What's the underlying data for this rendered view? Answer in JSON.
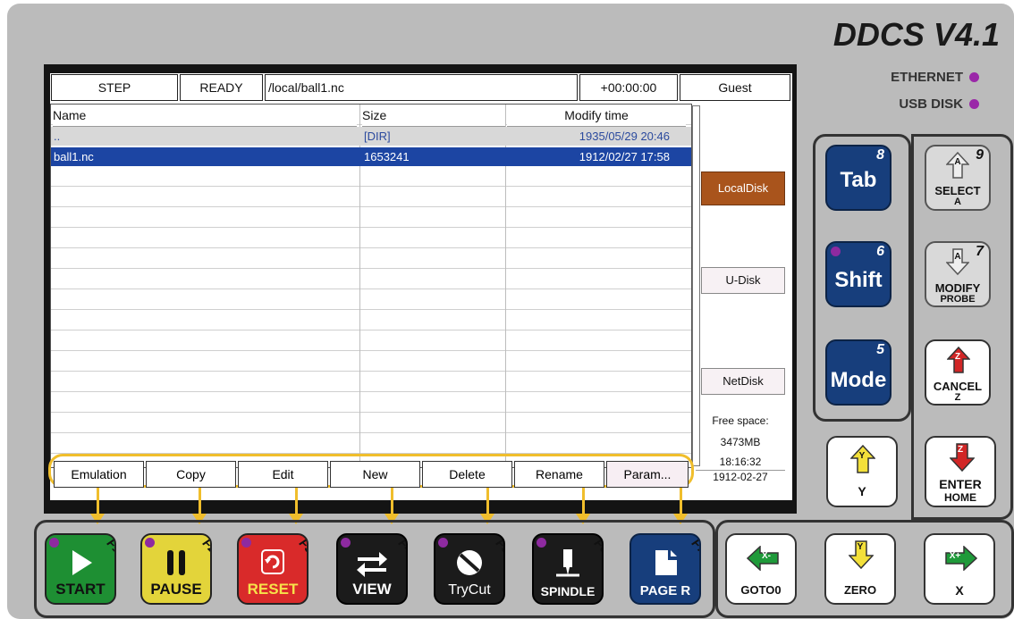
{
  "brand": "DDCS V4.1",
  "indicators": {
    "ethernet": "ETHERNET",
    "usb": "USB DISK"
  },
  "status_bar": {
    "mode": "STEP",
    "state": "READY",
    "path": "/local/ball1.nc",
    "timer": "+00:00:00",
    "user": "Guest"
  },
  "table": {
    "headers": {
      "name": "Name",
      "size": "Size",
      "modified": "Modify time"
    },
    "rows": [
      {
        "name": "..",
        "size": "[DIR]",
        "modified": "1935/05/29 20:46"
      },
      {
        "name": "ball1.nc",
        "size": "1653241",
        "modified": "1912/02/27 17:58"
      }
    ]
  },
  "side": {
    "local": "LocalDisk",
    "udisk": "U-Disk",
    "netdisk": "NetDisk",
    "free_label": "Free space:",
    "free_value": "3473MB",
    "time": "18:16:32",
    "date": "1912-02-27"
  },
  "fkeys": [
    "Emulation",
    "Copy",
    "Edit",
    "New",
    "Delete",
    "Rename",
    "Param..."
  ],
  "keys": {
    "tab": {
      "label": "Tab",
      "num": "8"
    },
    "shift": {
      "label": "Shift",
      "num": "6"
    },
    "mode": {
      "label": "Mode",
      "num": "5"
    },
    "select": {
      "label": "SELECT",
      "sub": "A",
      "num": "9",
      "glyph": "A"
    },
    "modify": {
      "label": "MODIFY",
      "sub": "PROBE",
      "num": "7",
      "glyph": "A"
    },
    "cancel": {
      "label": "CANCEL",
      "sub": "Z",
      "glyph": "Z"
    },
    "y": {
      "label": "Y",
      "glyph": "Y"
    },
    "enter": {
      "label": "ENTER",
      "sub": "HOME",
      "glyph": "Z"
    },
    "goto0": {
      "label": "GOTO0",
      "glyph": "X-"
    },
    "zero": {
      "label": "ZERO",
      "glyph": "Y"
    },
    "x": {
      "label": "X",
      "glyph": "X+"
    }
  },
  "bottom_keys": [
    {
      "id": "start",
      "label": "START",
      "fn": "F1",
      "bg": "#1e8f33",
      "fg": "#111"
    },
    {
      "id": "pause",
      "label": "PAUSE",
      "fn": "F2",
      "bg": "#e3d43a",
      "fg": "#111"
    },
    {
      "id": "reset",
      "label": "RESET",
      "fn": "F3",
      "bg": "#d92a2a",
      "fg": "#f6e24a"
    },
    {
      "id": "view",
      "label": "VIEW",
      "fn": "F4",
      "bg": "#1b1b1b",
      "fg": "#fff"
    },
    {
      "id": "trycut",
      "label": "TryCut",
      "fn": "F5",
      "bg": "#1b1b1b",
      "fg": "#fff"
    },
    {
      "id": "spindle",
      "label": "SPINDLE",
      "fn": "F6",
      "bg": "#1b1b1b",
      "fg": "#fff"
    },
    {
      "id": "page-r",
      "label": "PAGE R",
      "fn": "F7",
      "bg": "#173e7c",
      "fg": "#fff"
    }
  ],
  "colors": {
    "selection": "#1c45a3",
    "dir_row": "#d8d8d8",
    "local_disk": "#a9541c",
    "accent_yellow": "#f0be2c",
    "purple": "#8e2aa0"
  }
}
